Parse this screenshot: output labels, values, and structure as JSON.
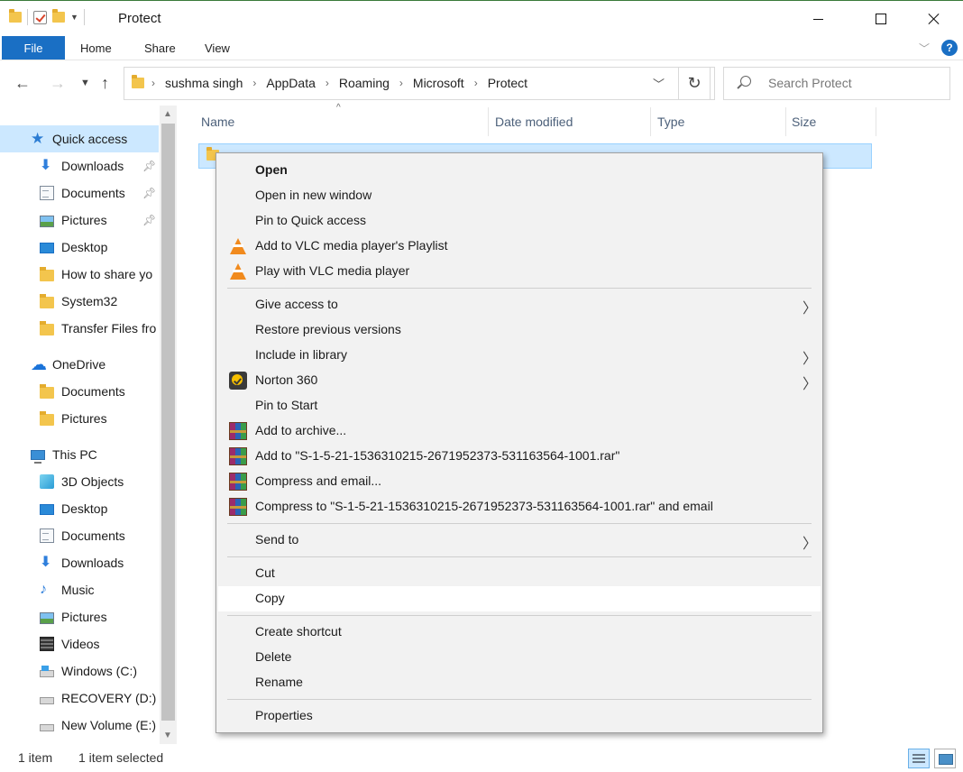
{
  "window": {
    "title": "Protect"
  },
  "ribbon": {
    "tabs": [
      "File",
      "Home",
      "Share",
      "View"
    ]
  },
  "address": {
    "crumbs": [
      "sushma singh",
      "AppData",
      "Roaming",
      "Microsoft",
      "Protect"
    ],
    "search_placeholder": "Search Protect"
  },
  "sidebar": {
    "quick_access": "Quick access",
    "qa_items": [
      "Downloads",
      "Documents",
      "Pictures",
      "Desktop",
      "How to share yo",
      "System32",
      "Transfer Files fro"
    ],
    "onedrive": "OneDrive",
    "onedrive_items": [
      "Documents",
      "Pictures"
    ],
    "this_pc": "This PC",
    "pc_items": [
      "3D Objects",
      "Desktop",
      "Documents",
      "Downloads",
      "Music",
      "Pictures",
      "Videos",
      "Windows (C:)",
      "RECOVERY (D:)",
      "New Volume (E:)"
    ]
  },
  "columns": [
    "Name",
    "Date modified",
    "Type",
    "Size"
  ],
  "context_menu": {
    "items": [
      "Open",
      "Open in new window",
      "Pin to Quick access",
      "Add to VLC media player's Playlist",
      "Play with VLC media player",
      "Give access to",
      "Restore previous versions",
      "Include in library",
      "Norton 360",
      "Pin to Start",
      "Add to archive...",
      "Add to \"S-1-5-21-1536310215-2671952373-531163564-1001.rar\"",
      "Compress and email...",
      "Compress to \"S-1-5-21-1536310215-2671952373-531163564-1001.rar\" and email",
      "Send to",
      "Cut",
      "Copy",
      "Create shortcut",
      "Delete",
      "Rename",
      "Properties"
    ]
  },
  "status": {
    "count": "1 item",
    "selected": "1 item selected"
  }
}
